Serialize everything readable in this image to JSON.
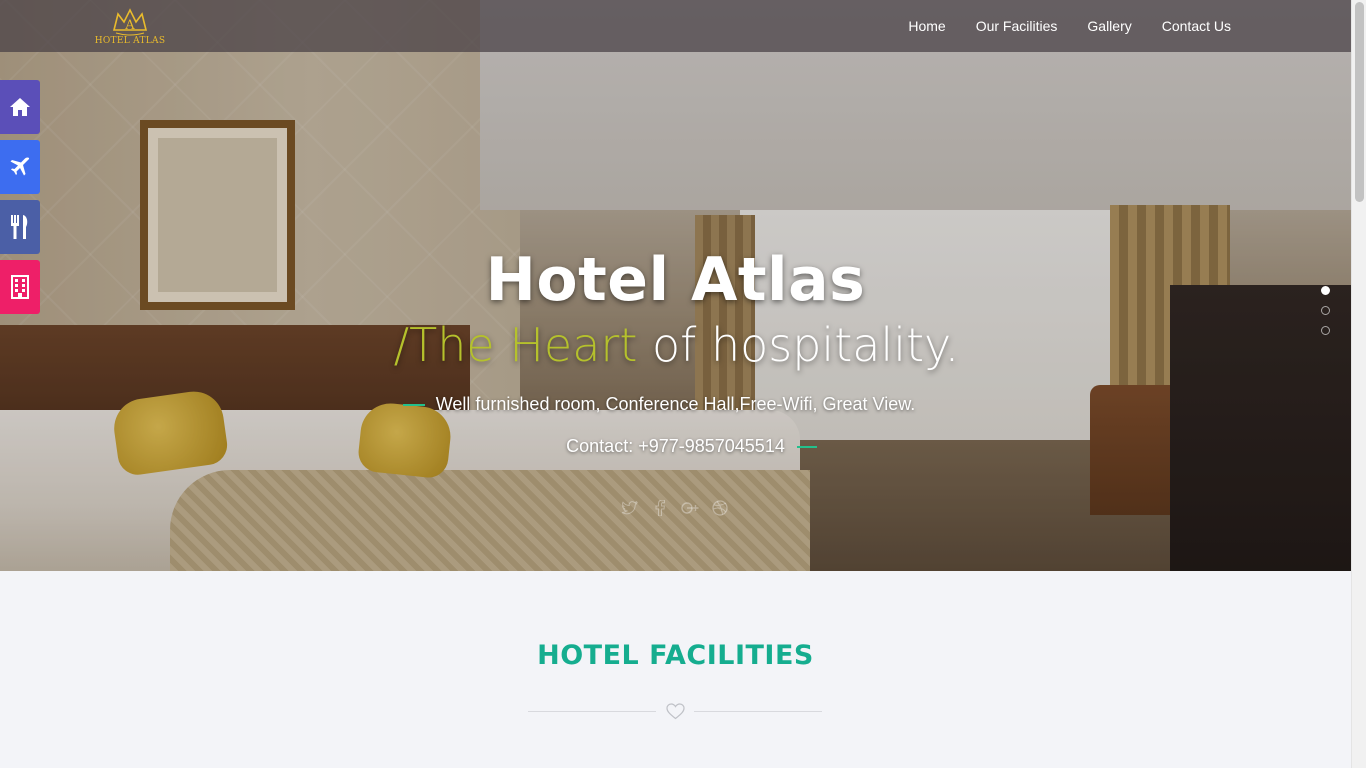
{
  "brand": {
    "logo_text": "HOTEL ATLAS",
    "logo_letter": "A"
  },
  "nav": {
    "items": [
      "Home",
      "Our Facilities",
      "Gallery",
      "Contact Us"
    ]
  },
  "side_icons": [
    {
      "icon": "home-icon",
      "color": "#5b4fb8"
    },
    {
      "icon": "plane-icon",
      "color": "#3d6df0"
    },
    {
      "icon": "restaurant-icon",
      "color": "#4b5fa6"
    },
    {
      "icon": "building-icon",
      "color": "#ee1f68"
    }
  ],
  "hero": {
    "title": "Hotel Atlas",
    "subtitle_accent": "/The Heart",
    "subtitle_rest": " of hospitality.",
    "tagline": "Well furnished room, Conference Hall,Free-Wifi, Great View.",
    "contact": "Contact: +977-9857045514",
    "socials": [
      "twitter-icon",
      "facebook-icon",
      "google-plus-icon",
      "dribbble-icon"
    ],
    "slides": 3,
    "active_slide": 1
  },
  "facilities": {
    "title": "HOTEL FACILITIES"
  },
  "colors": {
    "accent": "#b5c12c",
    "teal": "#15ad8f",
    "green_dash": "#23c08c"
  }
}
